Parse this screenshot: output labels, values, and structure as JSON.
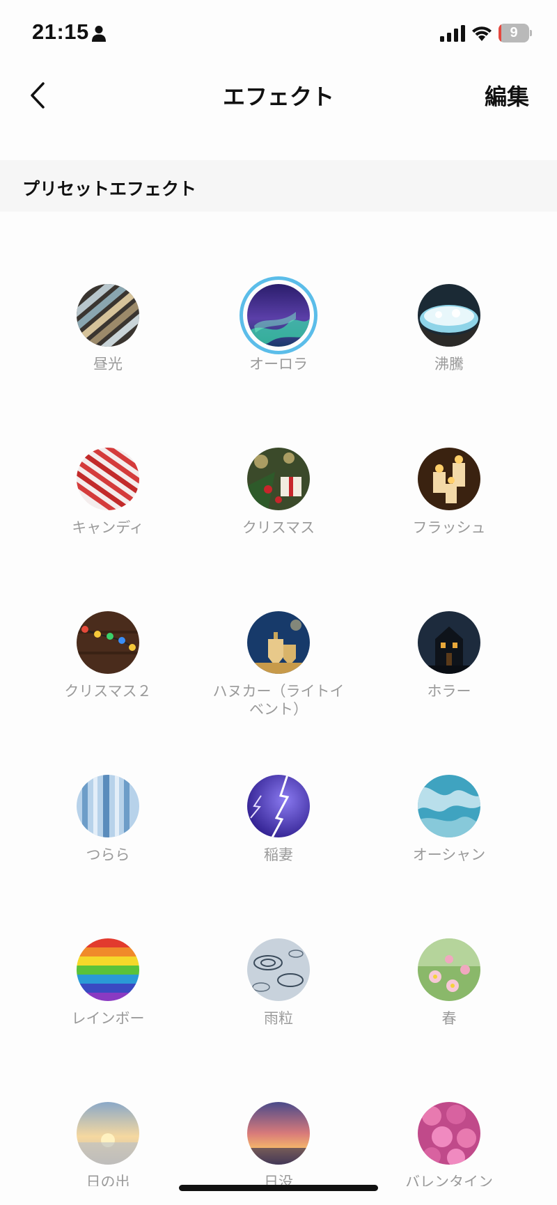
{
  "status_bar": {
    "time": "21:15",
    "battery_percent": "9",
    "battery_level": 0.09
  },
  "nav": {
    "title": "エフェクト",
    "edit_label": "編集"
  },
  "section": {
    "title": "プリセットエフェクト"
  },
  "effects": [
    {
      "label": "昼光",
      "selected": false
    },
    {
      "label": "オーロラ",
      "selected": true
    },
    {
      "label": "沸騰",
      "selected": false
    },
    {
      "label": "キャンディ",
      "selected": false
    },
    {
      "label": "クリスマス",
      "selected": false
    },
    {
      "label": "フラッシュ",
      "selected": false
    },
    {
      "label": "クリスマス２",
      "selected": false
    },
    {
      "label": "ハヌカー（ライトイベント）",
      "selected": false
    },
    {
      "label": "ホラー",
      "selected": false
    },
    {
      "label": "つらら",
      "selected": false
    },
    {
      "label": "稲妻",
      "selected": false
    },
    {
      "label": "オーシャン",
      "selected": false
    },
    {
      "label": "レインボー",
      "selected": false
    },
    {
      "label": "雨粒",
      "selected": false
    },
    {
      "label": "春",
      "selected": false
    },
    {
      "label": "日の出",
      "selected": false
    },
    {
      "label": "日没",
      "selected": false
    },
    {
      "label": "バレンタイン",
      "selected": false
    }
  ]
}
